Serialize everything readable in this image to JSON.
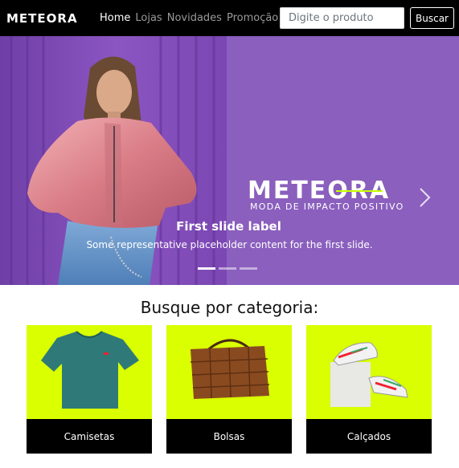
{
  "nav": {
    "brand": "METEORA",
    "links": [
      "Home",
      "Lojas",
      "Novidades",
      "Promoção"
    ],
    "search_placeholder": "Digite o produto",
    "search_button": "Buscar"
  },
  "hero": {
    "logo": "METEORA",
    "tagline": "MODA DE IMPACTO POSITIVO",
    "caption_title": "First slide label",
    "caption_text": "Some representative placeholder content for the first slide.",
    "slides_total": 3,
    "active_slide": 1
  },
  "categories": {
    "heading": "Busque por categoria:",
    "items": [
      "Camisetas",
      "Bolsas",
      "Calçados"
    ]
  },
  "colors": {
    "nav_bg": "#000000",
    "hero_bg": "#8a5fbd",
    "card_bg": "#d9ff00",
    "accent": "#c8ff00"
  }
}
